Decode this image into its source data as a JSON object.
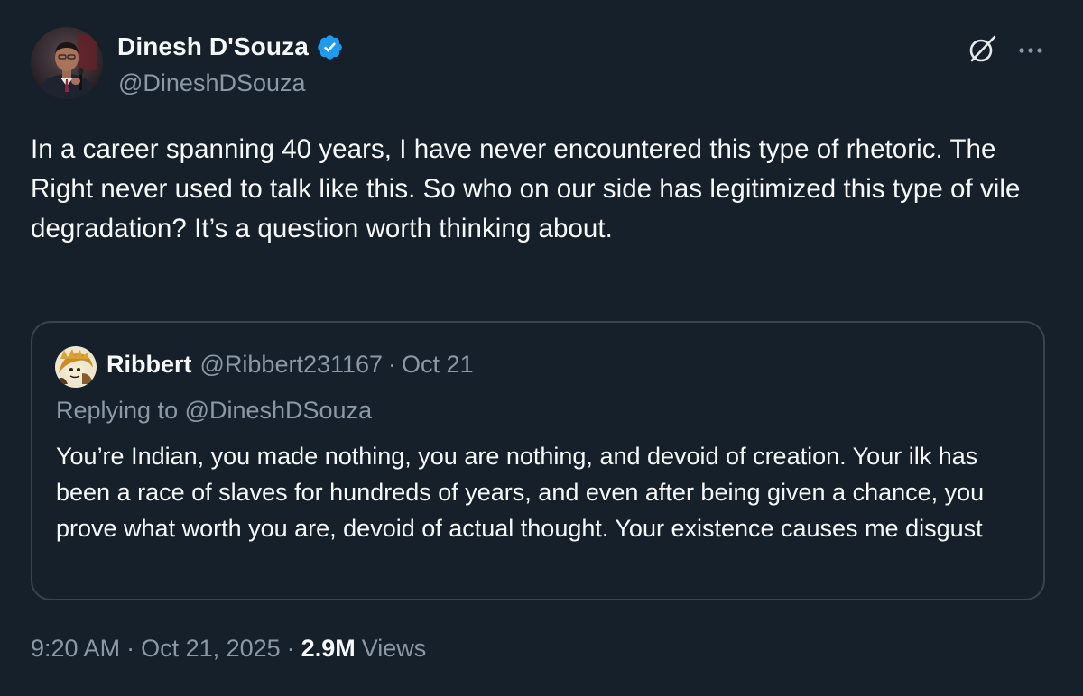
{
  "author": {
    "display_name": "Dinesh D'Souza",
    "handle": "@DineshDSouza",
    "verified": true,
    "avatar": "speaker-at-podium-photo"
  },
  "header_actions": {
    "grok_icon": "grok-slash-circle-icon",
    "more_icon": "more-horizontal-icon"
  },
  "tweet": {
    "text": "In a career spanning 40 years, I have never encountered this type of rhetoric. The Right never used to talk like this. So who on our side has legitimized this type of vile degradation? It’s a question worth thinking about."
  },
  "quoted": {
    "display_name": "Ribbert",
    "handle": "@Ribbert231167",
    "separator": "·",
    "date": "Oct 21",
    "replying_to": "Replying to @DineshDSouza",
    "text": "You’re Indian, you made nothing, you are nothing, and devoid of creation. Your ilk has been a race of slaves for hundreds of years, and even after being given a chance, you prove what worth you are, devoid of actual thought. Your existence causes me disgust",
    "avatar": "cartoon-avatar"
  },
  "meta": {
    "time": "9:20 AM",
    "separator": "·",
    "date": "Oct 21, 2025",
    "views_count": "2.9M",
    "views_label": "Views"
  },
  "colors": {
    "background": "#15202b",
    "primary_text": "#f7f9f9",
    "secondary_text": "#8b98a5",
    "border": "#38444d",
    "verified_blue": "#1d9bf0"
  }
}
